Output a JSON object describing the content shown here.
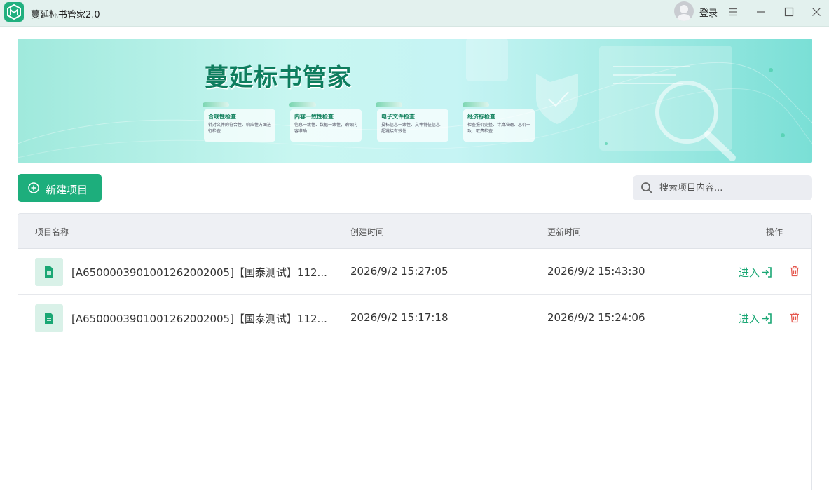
{
  "window": {
    "title": "蔓延标书管家2.0",
    "login_label": "登录"
  },
  "banner": {
    "title": "蔓延标书管家",
    "features": [
      {
        "title": "合规性检查",
        "desc": "针对文件的符合性、响应性方面进行检查"
      },
      {
        "title": "内容一致性检查",
        "desc": "信息一致性、数据一致性，确保内容准确"
      },
      {
        "title": "电子文件检查",
        "desc": "投标信息一致性、文件特征信息、超链接有效性"
      },
      {
        "title": "经济标检查",
        "desc": "检查报价完整、计算准确、总价一致、取费检查"
      }
    ]
  },
  "toolbar": {
    "new_label": "新建项目",
    "search_placeholder": "搜索项目内容..."
  },
  "table": {
    "headers": {
      "name": "项目名称",
      "created": "创建时间",
      "updated": "更新时间",
      "actions": "操作"
    },
    "rows": [
      {
        "name": "[A650000390100126200200​5]【国泰测试】112...",
        "created": "2026/9/2 15:27:05",
        "updated": "2026/9/2 15:43:30",
        "enter": "进入"
      },
      {
        "name": "[A650000390100126200200​5]【国泰测试】112...",
        "created": "2026/9/2 15:17:18",
        "updated": "2026/9/2 15:24:06",
        "enter": "进入"
      }
    ]
  },
  "icons": {
    "logo": "app-logo-icon",
    "menu": "hamburger-menu-icon",
    "minimize": "minimize-icon",
    "maximize": "maximize-icon",
    "close": "close-icon",
    "add": "plus-circle-icon",
    "search": "search-icon",
    "file": "document-icon",
    "enter": "enter-arrow-icon",
    "delete": "trash-icon"
  },
  "colors": {
    "accent": "#1dae7c",
    "delete": "#e5584f",
    "titlebar": "#e3f1ee"
  }
}
